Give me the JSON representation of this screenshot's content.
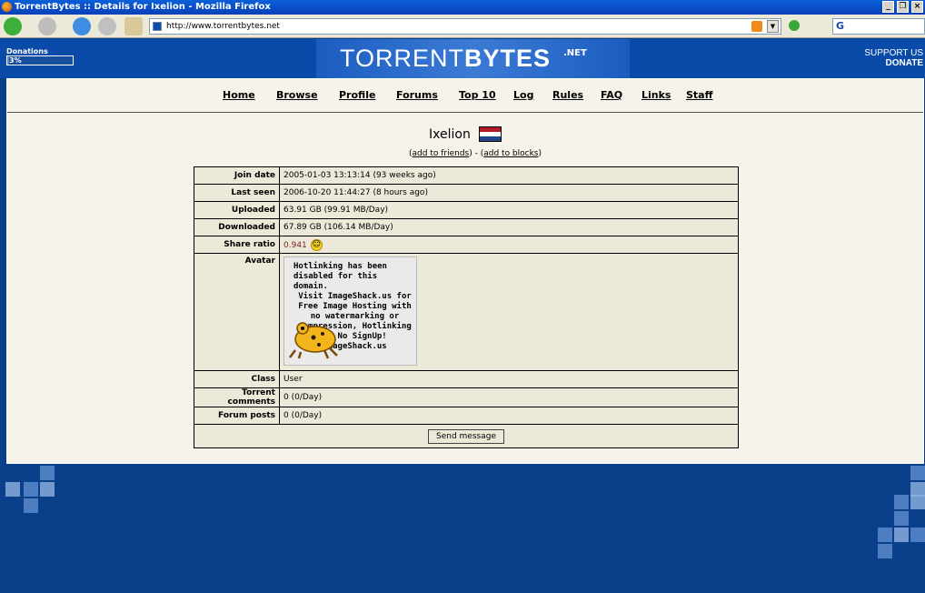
{
  "browser": {
    "title": "TorrentBytes :: Details for Ixelion - Mozilla Firefox",
    "url": "http://www.torrentbytes.net"
  },
  "header": {
    "donations_label": "Donations",
    "donations_percent": "3%",
    "donations_progress": 0.03,
    "logo_text_light": "TORRENT",
    "logo_text_bold": "BYTES",
    "logo_net": ".NET",
    "support_line1": "SUPPORT US",
    "support_line2": "DONATE"
  },
  "nav": {
    "items": [
      "Home",
      "Browse",
      "Profile",
      "Forums",
      "Top 10",
      "Log",
      "Rules",
      "FAQ",
      "Links",
      "Staff"
    ]
  },
  "profile": {
    "username": "Ixelion",
    "add_friends": "add to friends",
    "add_blocks": "add to blocks",
    "friends_open": "(",
    "friends_sep": ") - (",
    "friends_close": ")",
    "rows": {
      "join_date": {
        "label": "Join date",
        "value": "2005-01-03 13:13:14 (93 weeks ago)"
      },
      "last_seen": {
        "label": "Last seen",
        "value": "2006-10-20 11:44:27 (8 hours ago)"
      },
      "uploaded": {
        "label": "Uploaded",
        "value": "63.91 GB (99.91 MB/Day)"
      },
      "downloaded": {
        "label": "Downloaded",
        "value": "67.89 GB (106.14 MB/Day)"
      },
      "share_ratio": {
        "label": "Share ratio",
        "value": "0.941"
      },
      "avatar": {
        "label": "Avatar"
      },
      "class": {
        "label": "Class",
        "value": "User"
      },
      "torrent_comments": {
        "label": "Torrent comments",
        "value": "0 (0/Day)"
      },
      "forum_posts": {
        "label": "Forum posts",
        "value": "0 (0/Day)"
      }
    },
    "avatar_text_top": "Hotlinking has been disabled for this domain.",
    "avatar_text_bottom": "Visit ImageShack.us for Free Image Hosting with no watermarking or compression, Hotlinking OK No SignUp! ImageShack.us",
    "send_message": "Send message"
  },
  "colors": {
    "ratio_value": "#7a1f1f",
    "page_bg": "#0a3f8a"
  }
}
